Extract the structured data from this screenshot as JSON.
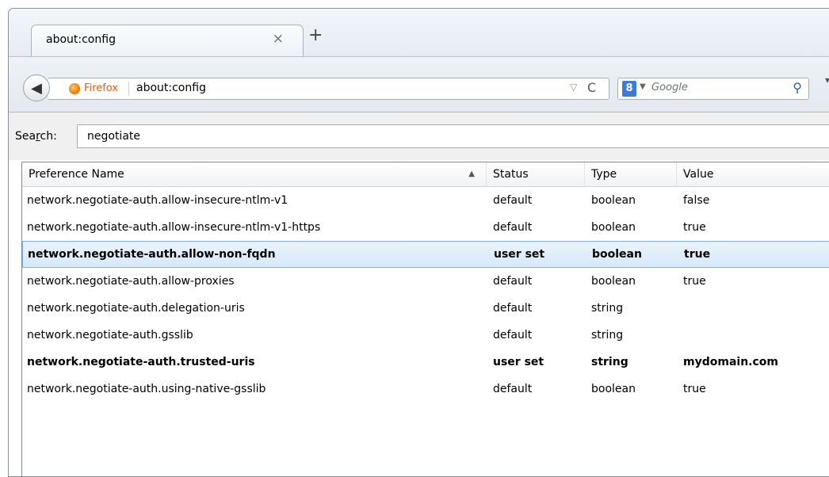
{
  "tab": {
    "title": "about:config",
    "close_glyph": "×",
    "new_tab_glyph": "+"
  },
  "navbar": {
    "identity": "Firefox",
    "url": "about:config",
    "dropmarker_glyph": "▽",
    "reload_glyph": "C",
    "search_engine_placeholder": "Google",
    "search_engine_letter": "8",
    "more_glyph": "▾"
  },
  "search": {
    "label_pre": "Sea",
    "label_accel": "r",
    "label_post": "ch:",
    "value": "negotiate"
  },
  "table": {
    "columns": [
      "Preference Name",
      "Status",
      "Type",
      "Value"
    ],
    "sort_indicator": "▲",
    "rows": [
      {
        "name": "network.negotiate-auth.allow-insecure-ntlm-v1",
        "status": "default",
        "type": "boolean",
        "value": "false"
      },
      {
        "name": "network.negotiate-auth.allow-insecure-ntlm-v1-https",
        "status": "default",
        "type": "boolean",
        "value": "true"
      },
      {
        "name": "network.negotiate-auth.allow-non-fqdn",
        "status": "user set",
        "type": "boolean",
        "value": "true"
      },
      {
        "name": "network.negotiate-auth.allow-proxies",
        "status": "default",
        "type": "boolean",
        "value": "true"
      },
      {
        "name": "network.negotiate-auth.delegation-uris",
        "status": "default",
        "type": "string",
        "value": ""
      },
      {
        "name": "network.negotiate-auth.gsslib",
        "status": "default",
        "type": "string",
        "value": ""
      },
      {
        "name": "network.negotiate-auth.trusted-uris",
        "status": "user set",
        "type": "string",
        "value": "mydomain.com"
      },
      {
        "name": "network.negotiate-auth.using-native-gsslib",
        "status": "default",
        "type": "boolean",
        "value": "true"
      }
    ],
    "selected_row": 2
  },
  "colors": {
    "identity": "#e05f0e",
    "selection_border": "#84acdd"
  }
}
